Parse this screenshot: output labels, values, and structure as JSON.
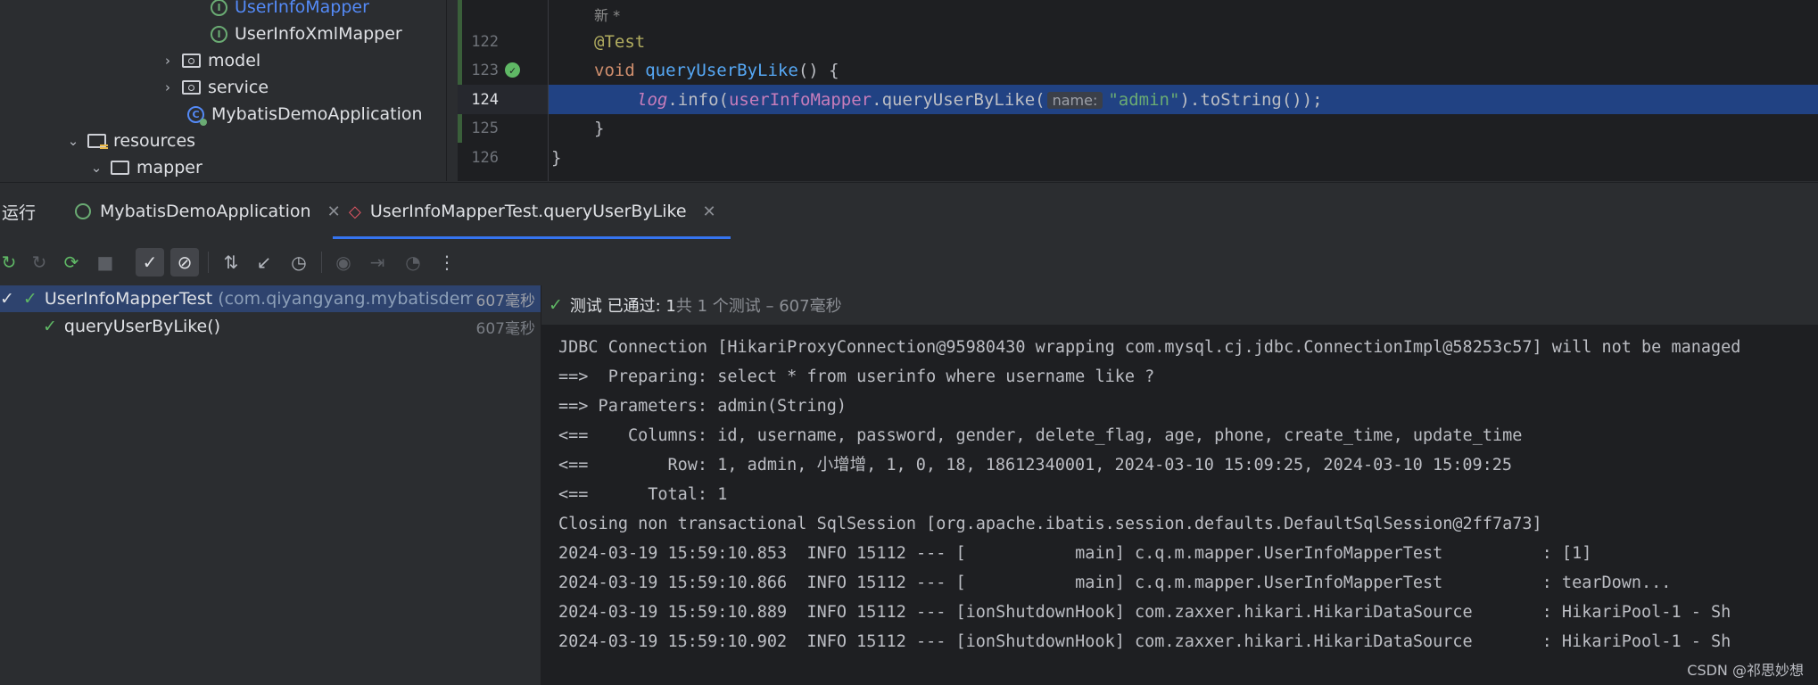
{
  "tree": {
    "items": [
      {
        "label": "UserInfoMapper",
        "icon": "interface-icon",
        "selected": true
      },
      {
        "label": "UserInfoXmlMapper",
        "icon": "interface-icon"
      },
      {
        "label": "model",
        "icon": "package-folder-icon"
      },
      {
        "label": "service",
        "icon": "package-folder-icon"
      },
      {
        "label": "MybatisDemoApplication",
        "icon": "spring-class-icon"
      },
      {
        "label": "resources",
        "icon": "resources-folder-icon"
      },
      {
        "label": "mapper",
        "icon": "folder-icon"
      }
    ]
  },
  "editor": {
    "comment": "新 *",
    "lines": [
      {
        "no": "122",
        "annotation": "@Test"
      },
      {
        "no": "123",
        "kw": "void",
        "fn": "queryUserByLike",
        "rest": "() {"
      },
      {
        "no": "124",
        "log": "log",
        "dot_info": ".info(",
        "field": "userInfoMapper",
        "call": ".queryUserByLike(",
        "hint": "name:",
        "str": "\"admin\"",
        "tail": ").toString());"
      },
      {
        "no": "125",
        "rest": "}"
      },
      {
        "no": "126",
        "rest": "}"
      }
    ]
  },
  "run": {
    "label": "运行",
    "tabs": [
      {
        "label": "MybatisDemoApplication"
      },
      {
        "label": "UserInfoMapperTest.queryUserByLike",
        "active": true
      }
    ]
  },
  "toolbar": {
    "icons": [
      "rerun-icon",
      "rerun-failed-icon",
      "toggle-auto-test-icon",
      "stop-icon",
      "show-passed-icon",
      "show-ignored-icon",
      "sort-icon",
      "collapse-icon",
      "history-icon",
      "screenshot-icon",
      "export-icon",
      "coverage-icon",
      "more-icon"
    ]
  },
  "testtree": {
    "root": {
      "name": "UserInfoMapperTest",
      "pkg": "(com.qiyangyang.mybatisdemo",
      "time": "607毫秒"
    },
    "child": {
      "name": "queryUserByLike()",
      "time": "607毫秒"
    }
  },
  "console": {
    "status_main": "测试 已通过: 1",
    "status_sub": "共 1 个测试 – 607毫秒",
    "lines": [
      "JDBC Connection [HikariProxyConnection@95980430 wrapping com.mysql.cj.jdbc.ConnectionImpl@58253c57] will not be managed",
      "==>  Preparing: select * from userinfo where username like ?",
      "==> Parameters: admin(String)",
      "<==    Columns: id, username, password, gender, delete_flag, age, phone, create_time, update_time",
      "<==        Row: 1, admin, 小增增, 1, 0, 18, 18612340001, 2024-03-10 15:09:25, 2024-03-10 15:09:25",
      "<==      Total: 1",
      "Closing non transactional SqlSession [org.apache.ibatis.session.defaults.DefaultSqlSession@2ff7a73]",
      "2024-03-19 15:59:10.853  INFO 15112 --- [           main] c.q.m.mapper.UserInfoMapperTest          : [1]",
      "2024-03-19 15:59:10.866  INFO 15112 --- [           main] c.q.m.mapper.UserInfoMapperTest          : tearDown...",
      "2024-03-19 15:59:10.889  INFO 15112 --- [ionShutdownHook] com.zaxxer.hikari.HikariDataSource       : HikariPool-1 - Sh",
      "2024-03-19 15:59:10.902  INFO 15112 --- [ionShutdownHook] com.zaxxer.hikari.HikariDataSource       : HikariPool-1 - Sh"
    ]
  },
  "watermark": "CSDN @祁思妙想",
  "colors": {
    "accent": "#3574f0",
    "pass": "#5fb865",
    "selection": "#214283"
  }
}
